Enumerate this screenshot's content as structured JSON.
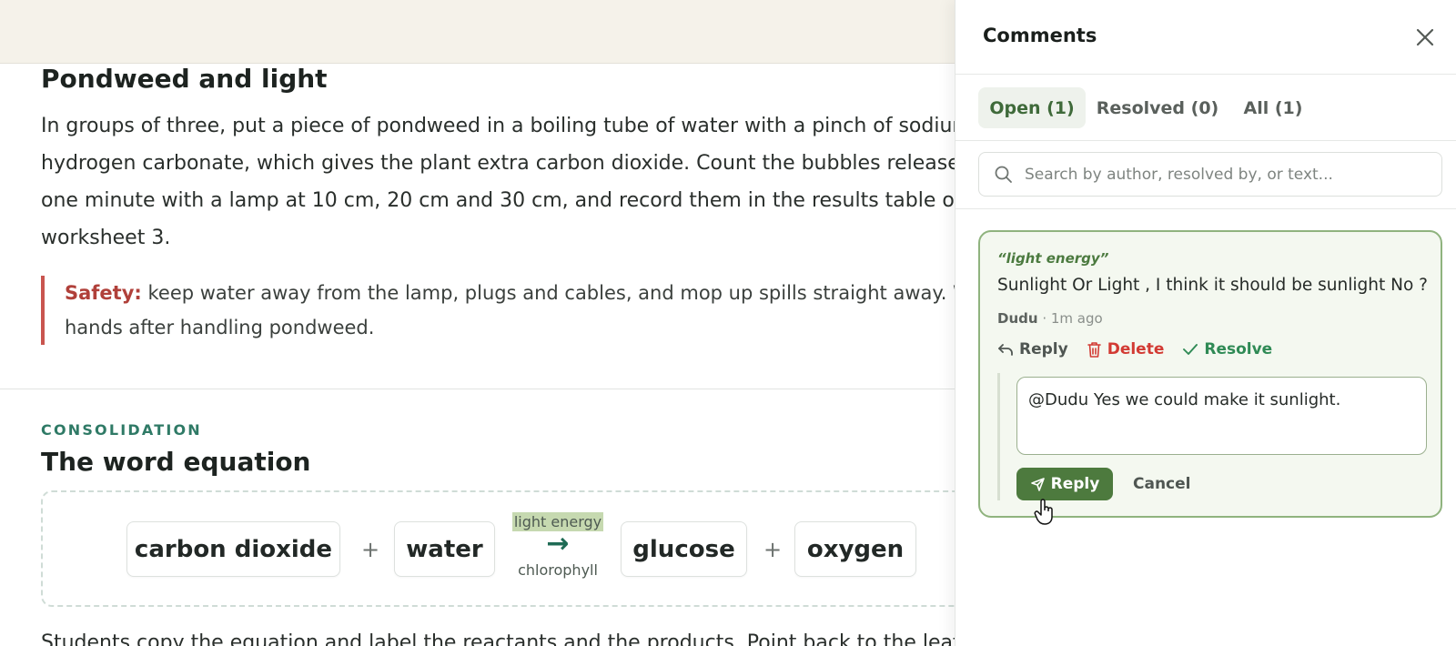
{
  "doc": {
    "heading": "Pondweed and light",
    "paragraph_lines": [
      "In groups of three, put a piece of pondweed in a boiling tube of water with a pinch of sodium",
      "hydrogen carbonate, which gives the plant extra carbon dioxide. Count the bubbles released in",
      "one minute with a lamp at 10 cm, 20 cm and 30 cm, and record them in the results table on",
      "worksheet 3."
    ],
    "safety_label": "Safety:",
    "safety_line1": " keep water away from the lamp, plugs and cables, and mop up spills straight away. Wash",
    "safety_line2": "hands after handling pondweed.",
    "section_eyebrow": "CONSOLIDATION",
    "section_heading": "The word equation",
    "equation": {
      "reactant1": "carbon dioxide",
      "plus1": "+",
      "reactant2": "water",
      "arrow_top": "light energy",
      "arrow": "→",
      "arrow_bottom": "chlorophyll",
      "product1": "glucose",
      "plus2": "+",
      "product2": "oxygen"
    },
    "bottom_text": "Students copy the equation and label the reactants and the products. Point back to the leaf"
  },
  "comments": {
    "title": "Comments",
    "tabs": [
      {
        "label": "Open (1)",
        "active": true
      },
      {
        "label": "Resolved (0)",
        "active": false
      },
      {
        "label": "All (1)",
        "active": false
      }
    ],
    "search_placeholder": "Search by author, resolved by, or text...",
    "thread": {
      "quote": "“light energy”",
      "text": "Sunlight Or Light , I think it should be sunlight No ?",
      "author": "Dudu",
      "time": " · 1m ago",
      "actions": {
        "reply": "Reply",
        "delete": "Delete",
        "resolve": "Resolve"
      },
      "reply_value": "@Dudu Yes we could make it sunlight.",
      "reply_button": "Reply",
      "cancel_button": "Cancel"
    }
  },
  "colors": {
    "accent_green": "#4d7a3e",
    "delete_red": "#d23a33",
    "resolve_green": "#2f8a55",
    "safety_red": "#c9554f",
    "highlight": "#c6d9b0"
  }
}
